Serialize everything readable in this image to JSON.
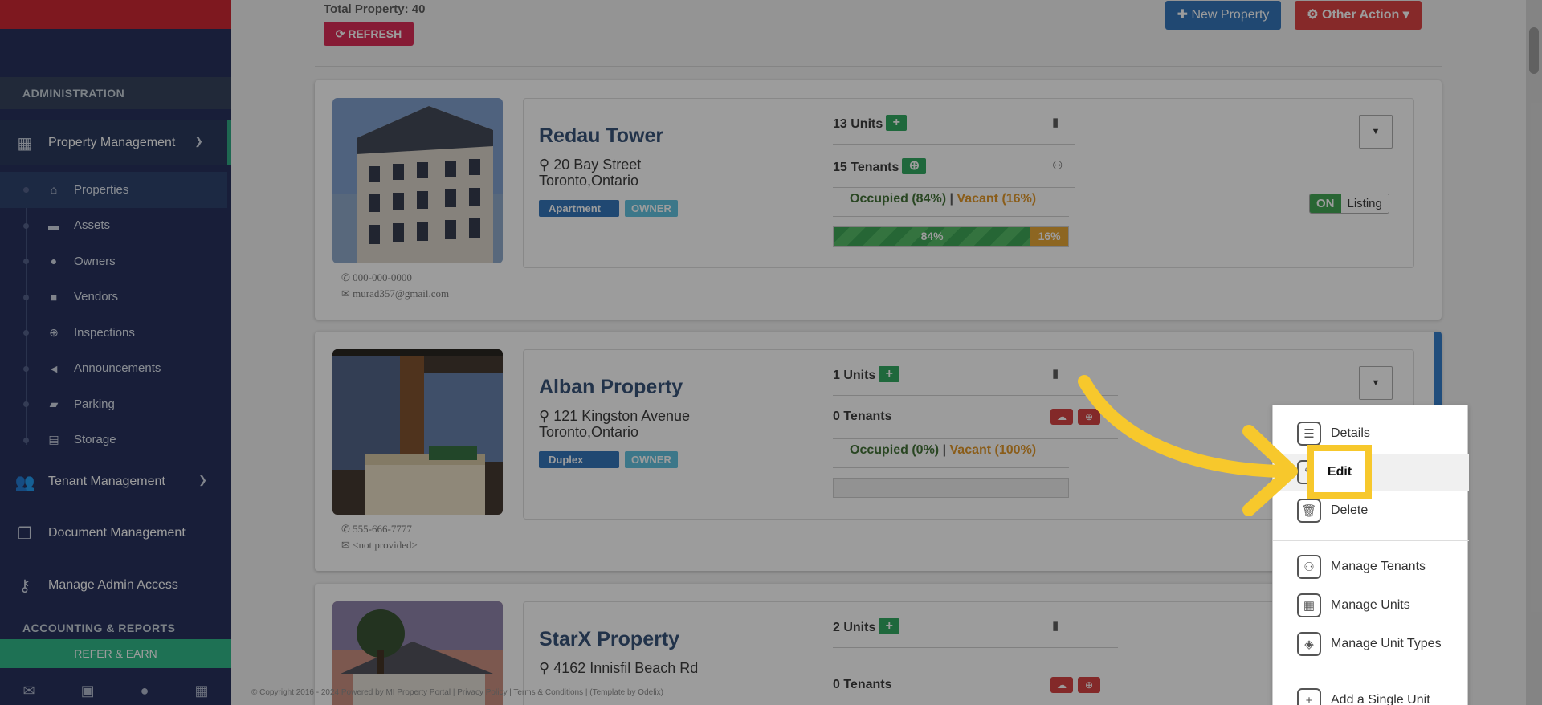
{
  "sidebar": {
    "admin_heading": "ADMINISTRATION",
    "property_management": "Property Management",
    "sub_items": [
      {
        "label": "Properties",
        "icon": "home-icon"
      },
      {
        "label": "Assets",
        "icon": "archive-icon"
      },
      {
        "label": "Owners",
        "icon": "user-icon"
      },
      {
        "label": "Vendors",
        "icon": "briefcase-icon"
      },
      {
        "label": "Inspections",
        "icon": "search-plus-icon"
      },
      {
        "label": "Announcements",
        "icon": "bullhorn-icon"
      },
      {
        "label": "Parking",
        "icon": "car-icon"
      },
      {
        "label": "Storage",
        "icon": "basket-icon"
      }
    ],
    "tenant_management": "Tenant Management",
    "document_management": "Document Management",
    "manage_admin_access": "Manage Admin Access",
    "accounting_heading": "ACCOUNTING & REPORTS",
    "refer": "REFER & EARN"
  },
  "header": {
    "total": "Total Property: 40",
    "refresh": "REFRESH",
    "new_property": "New Property",
    "other_action": "Other Action"
  },
  "properties": [
    {
      "name": "Redau Tower",
      "addr1": "20 Bay Street",
      "addr2": "Toronto,Ontario",
      "type": "Apartment",
      "role": "OWNER",
      "units": "13 Units",
      "tenants": "15 Tenants",
      "occupied": "Occupied (84%)",
      "vacant": "Vacant (16%)",
      "occupied_pct": 84,
      "vacant_pct": 16,
      "phone": "000-000-0000",
      "email": "murad357@gmail.com",
      "listing_on": "ON",
      "listing_label": "Listing"
    },
    {
      "name": "Alban Property",
      "addr1": "121 Kingston Avenue",
      "addr2": "Toronto,Ontario",
      "type": "Duplex",
      "role": "OWNER",
      "units": "1 Units",
      "tenants": "0 Tenants",
      "occupied": "Occupied (0%)",
      "vacant": "Vacant (100%)",
      "occupied_pct": 0,
      "vacant_pct": 0,
      "phone": "555-666-7777",
      "email": "<not provided>"
    },
    {
      "name": "StarX Property",
      "addr1": "4162 Innisfil Beach Rd",
      "units": "2 Units",
      "tenants": "0 Tenants"
    }
  ],
  "menu": {
    "details": "Details",
    "edit": "Edit",
    "delete": "Delete",
    "manage_tenants": "Manage Tenants",
    "manage_units": "Manage Units",
    "manage_unit_types": "Manage Unit Types",
    "add_single_unit": "Add a Single Unit"
  },
  "footer": "© Copyright 2016 - 2024 Powered by MI Property Portal | Privacy Policy | Terms & Conditions | (Template by Odelix)",
  "colors": {
    "sidebar": "#1c2755",
    "accent_green": "#27b584",
    "highlight_yellow": "#f7c82c",
    "brand_red": "#cc1d28"
  }
}
